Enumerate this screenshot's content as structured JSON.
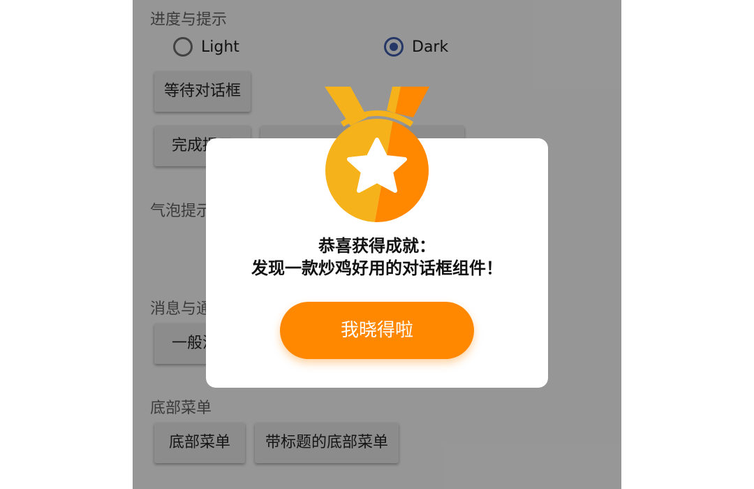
{
  "sections": {
    "progress": "进度与提示",
    "bubble": "气泡提示",
    "message": "消息与通知",
    "bottom": "底部菜单"
  },
  "theme": {
    "light_label": "Light",
    "dark_label": "Dark",
    "selected": "Dark"
  },
  "buttons": {
    "wait_dialog": "等待对话框",
    "complete_prefix": "完成提示",
    "general_message": "一般消息",
    "bottom_menu": "底部菜单",
    "titled_bottom_menu": "带标题的底部菜单"
  },
  "dialog": {
    "title_line1": "恭喜获得成就：",
    "title_line2": "发现一款炒鸡好用的对话框组件！",
    "confirm_label": "我晓得啦",
    "icon": "medal-icon"
  },
  "colors": {
    "accent": "#ff8800",
    "medal_light": "#f5b21b",
    "medal_dark": "#ff8800",
    "radio_selected": "#3c5aa6"
  }
}
